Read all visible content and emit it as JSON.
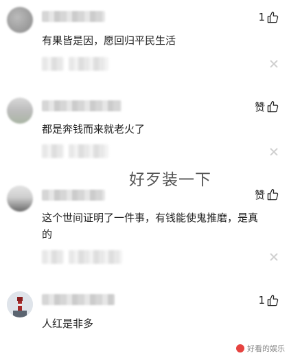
{
  "comments": [
    {
      "text": "有果皆是因，愿回归平民生活",
      "like_label": "1",
      "avatar_icon": "user-avatar-blurred",
      "like_icon": "thumbs-up-icon"
    },
    {
      "text": "都是奔钱而来就老火了",
      "like_label": "赞",
      "avatar_icon": "user-avatar-blurred",
      "like_icon": "thumbs-up-icon"
    },
    {
      "text_line1": "这个世间证明了一件事，有钱能使鬼推磨，是真",
      "text_line2": "的",
      "like_label": "赞",
      "avatar_icon": "user-avatar-blurred",
      "like_icon": "thumbs-up-icon"
    },
    {
      "text": "人红是非多",
      "like_label": "1",
      "avatar_icon": "user-avatar-lighthouse",
      "like_icon": "thumbs-up-icon"
    }
  ],
  "overlay_caption": "好歹装一下",
  "source_watermark": "好看的娱乐",
  "colors": {
    "text": "#222222",
    "close": "#cfcfcf",
    "watermark_accent": "#e64340"
  }
}
